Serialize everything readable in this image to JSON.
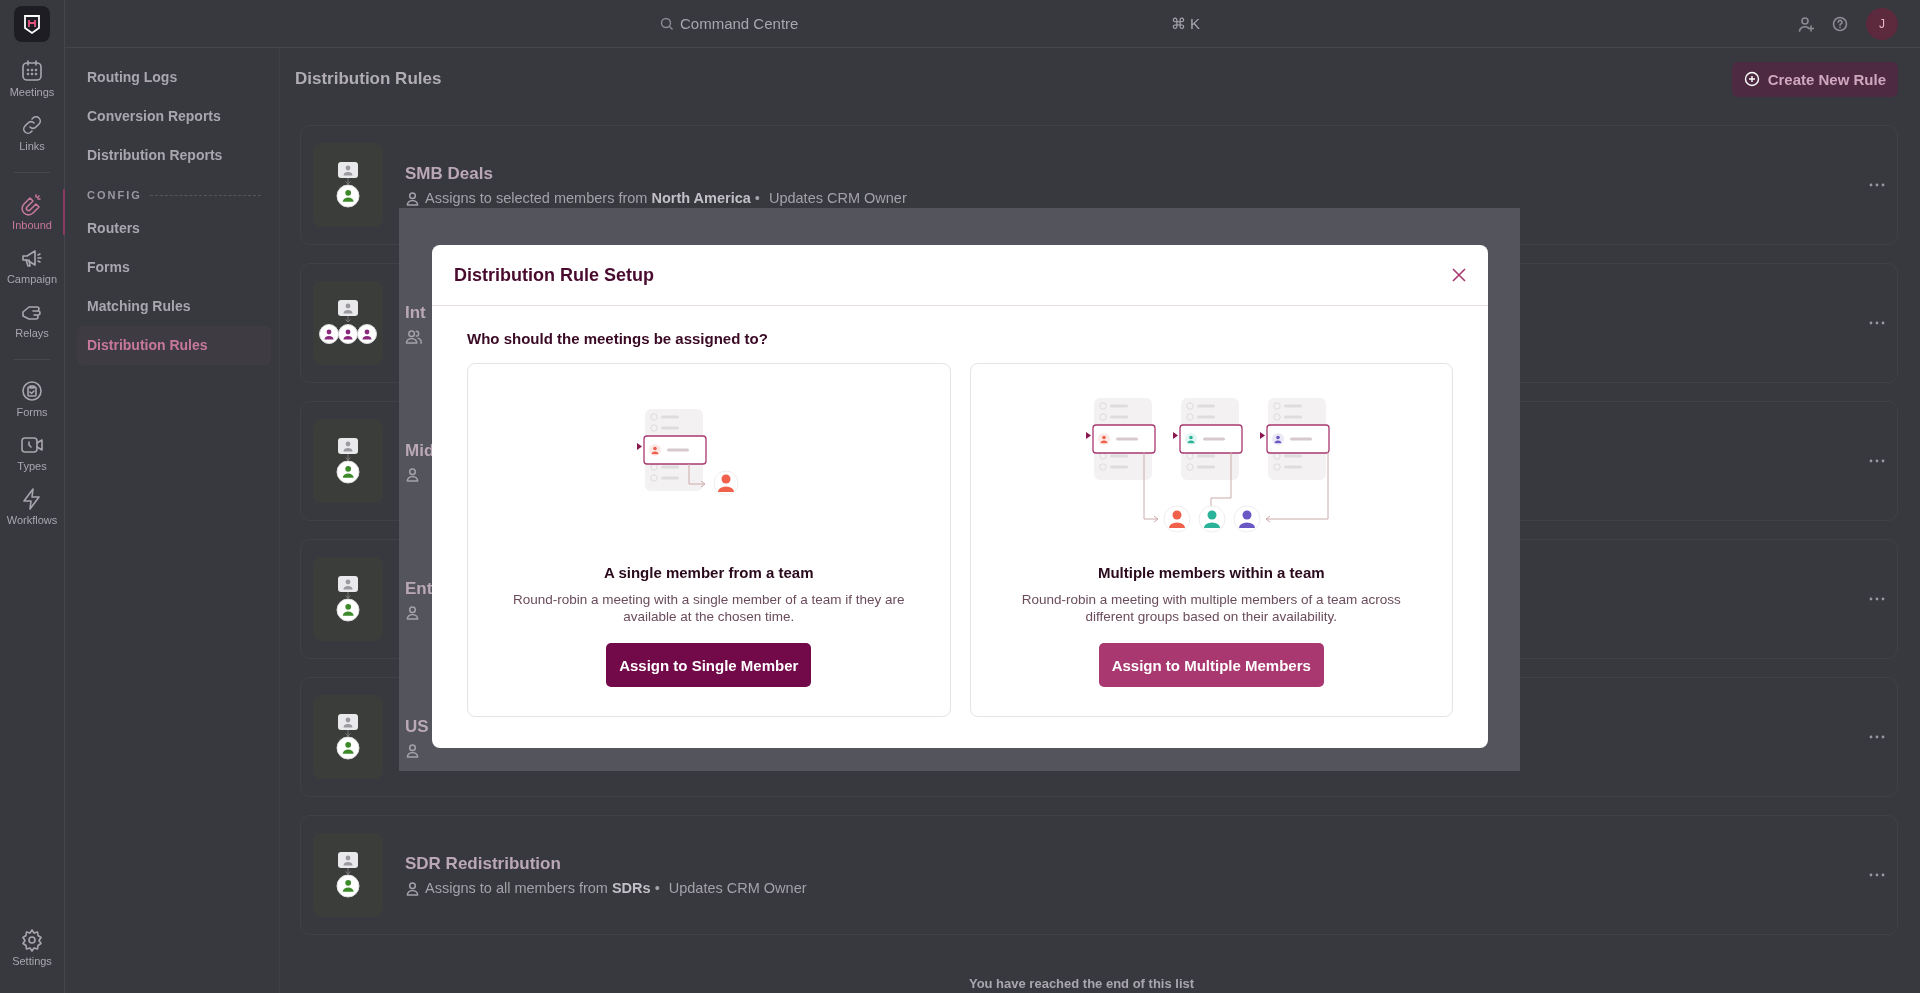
{
  "topbar": {
    "search": "Command Centre",
    "shortcut": "⌘ K",
    "avatar": "J"
  },
  "rail": {
    "groups": [
      [
        {
          "label": "Meetings",
          "selected": false
        },
        {
          "label": "Links",
          "selected": false
        }
      ],
      [
        {
          "label": "Inbound",
          "selected": true
        },
        {
          "label": "Campaign",
          "selected": false
        },
        {
          "label": "Relays",
          "selected": false
        }
      ],
      [
        {
          "label": "Forms",
          "selected": false
        },
        {
          "label": "Types",
          "selected": false
        },
        {
          "label": "Workflows",
          "selected": false
        }
      ]
    ],
    "settings": {
      "label": "Settings",
      "selected": false
    }
  },
  "subnav": {
    "items": [
      {
        "label": "Routing Logs",
        "selected": false
      },
      {
        "label": "Conversion Reports",
        "selected": false
      },
      {
        "label": "Distribution Reports",
        "selected": false
      }
    ],
    "section": "CONFIG",
    "config_items": [
      {
        "label": "Routers",
        "selected": false
      },
      {
        "label": "Forms",
        "selected": false
      },
      {
        "label": "Matching Rules",
        "selected": false
      },
      {
        "label": "Distribution Rules",
        "selected": true
      }
    ]
  },
  "page": {
    "title": "Distribution Rules",
    "create_button": "Create New Rule"
  },
  "rules": [
    {
      "kind": "single",
      "title": "SMB Deals",
      "assign": "Assigns to selected members from **North America** •",
      "crm": "Updates CRM Owner"
    },
    {
      "kind": "multi",
      "title": "Int"
    },
    {
      "kind": "single",
      "title": "Mid"
    },
    {
      "kind": "single",
      "title": "Ent"
    },
    {
      "kind": "single",
      "title": "US"
    },
    {
      "kind": "single",
      "title": "SDR Redistribution",
      "assign": "Assigns to all members from **SDRs** •",
      "crm": "Updates CRM Owner"
    }
  ],
  "end_note": "You have reached the end of this list",
  "modal": {
    "title": "Distribution Rule Setup",
    "question": "Who should the meetings be assigned to?",
    "options": [
      {
        "kind": "single",
        "title": "A single member from a team",
        "description": "Round-robin a meeting with a single member of a team if they are available at the chosen time.",
        "button": "Assign to Single Member"
      },
      {
        "kind": "multi",
        "title": "Multiple members within a team",
        "description": "Round-robin a meeting with multiple members of a team across different groups based on their availability.",
        "button": "Assign to Multiple Members"
      }
    ]
  }
}
